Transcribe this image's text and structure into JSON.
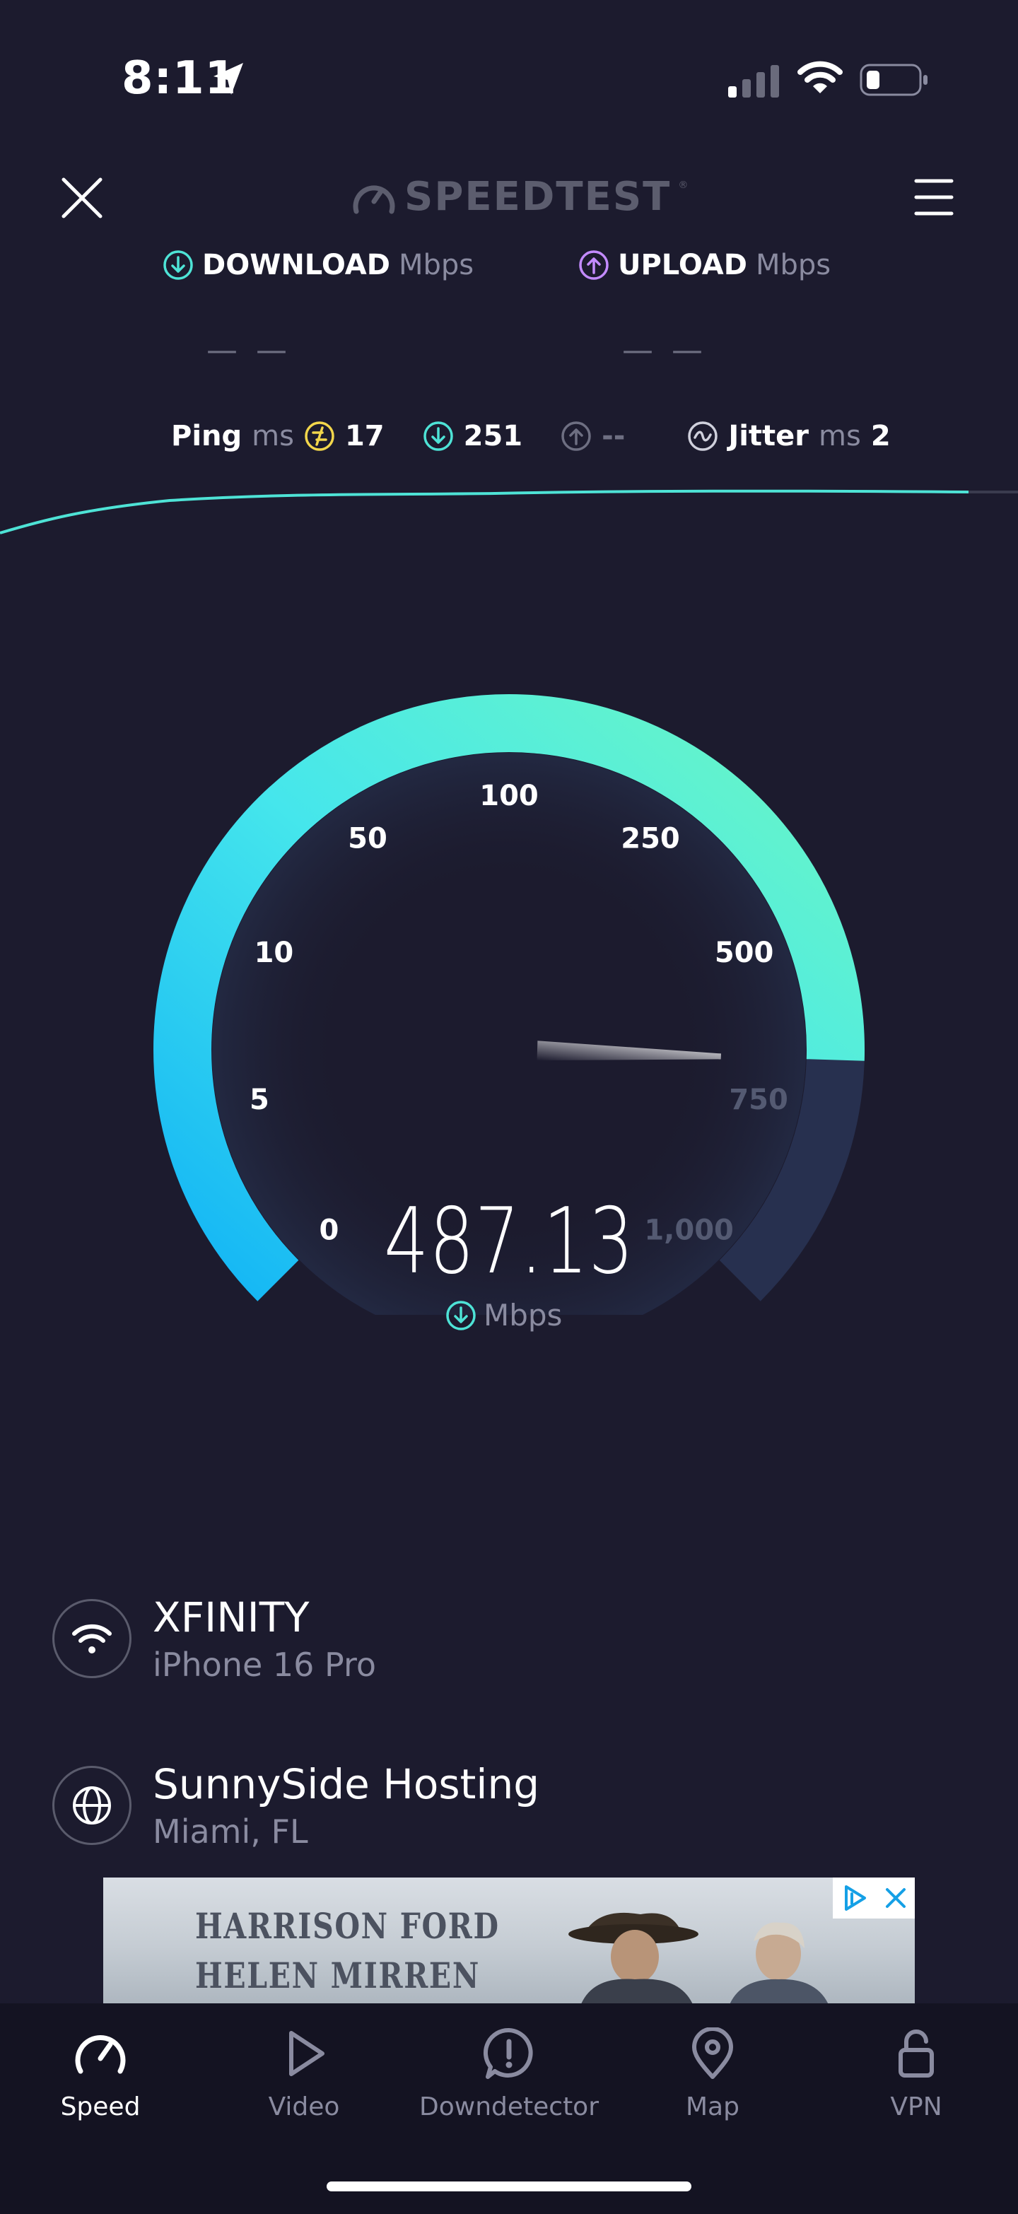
{
  "status_bar": {
    "time": "8:11"
  },
  "header": {
    "brand": "SPEEDTEST",
    "trademark": "®"
  },
  "download": {
    "label": "DOWNLOAD",
    "unit": "Mbps",
    "value": "— —"
  },
  "upload": {
    "label": "UPLOAD",
    "unit": "Mbps",
    "value": "— —"
  },
  "ping": {
    "label": "Ping",
    "unit": "ms",
    "idle": "17",
    "download": "251",
    "upload": "--"
  },
  "jitter": {
    "label": "Jitter",
    "unit": "ms",
    "value": "2"
  },
  "gauge": {
    "ticks": [
      "0",
      "5",
      "10",
      "50",
      "100",
      "250",
      "500",
      "750",
      "1,000"
    ],
    "current_value": "487.13",
    "unit": "Mbps",
    "progress_fraction": 0.84
  },
  "connection": {
    "provider": "XFINITY",
    "device": "iPhone 16 Pro",
    "server_name": "SunnySide Hosting",
    "server_location": "Miami, FL"
  },
  "ad": {
    "line1": "HARRISON FORD",
    "line2": "HELEN MIRREN"
  },
  "nav": {
    "items": [
      {
        "label": "Speed",
        "icon": "speed-gauge-icon",
        "active": true
      },
      {
        "label": "Video",
        "icon": "play-icon"
      },
      {
        "label": "Downdetector",
        "icon": "alert-icon"
      },
      {
        "label": "Map",
        "icon": "map-pin-icon"
      },
      {
        "label": "VPN",
        "icon": "lock-open-icon"
      }
    ]
  },
  "colors": {
    "background": "#1c1b2e",
    "accent_cyan": "#4ee3d6",
    "gauge_start": "#12b4f5",
    "gauge_end": "#6bf7c4",
    "gauge_track": "#27304f",
    "upload_purple": "#c38bff",
    "ping_yellow": "#f2d64b"
  }
}
